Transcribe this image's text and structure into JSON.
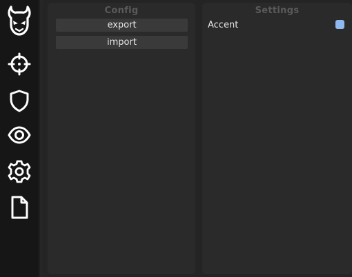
{
  "sidebar": {
    "icons": [
      {
        "name": "demon-logo-icon"
      },
      {
        "name": "crosshair-icon"
      },
      {
        "name": "shield-icon"
      },
      {
        "name": "eye-icon"
      },
      {
        "name": "gear-icon"
      },
      {
        "name": "file-icon"
      }
    ]
  },
  "config": {
    "title": "Config",
    "export_label": "export",
    "import_label": "import"
  },
  "settings": {
    "title": "Settings",
    "accent_label": "Accent",
    "accent_color": "#8fb8f0"
  }
}
